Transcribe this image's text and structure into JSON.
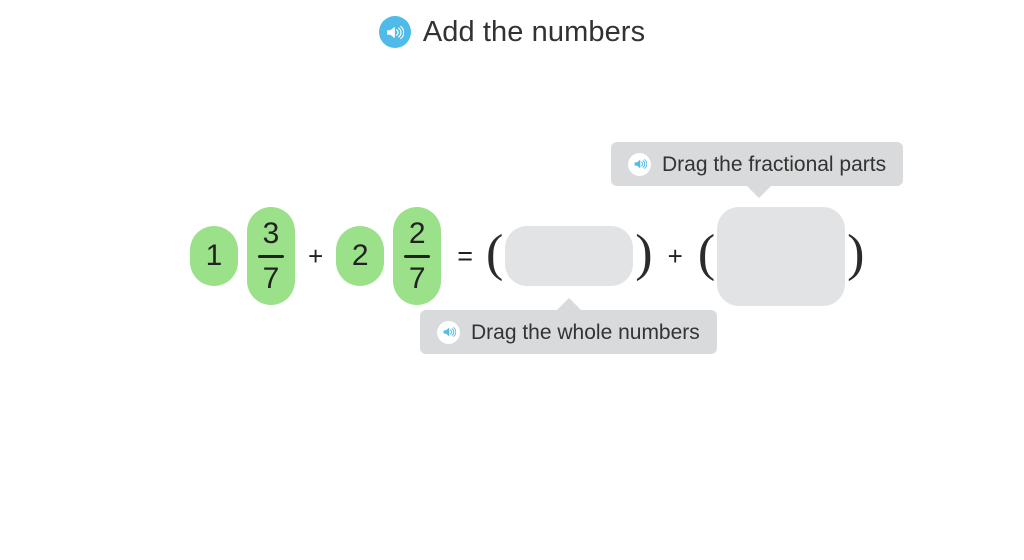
{
  "header": {
    "title": "Add the numbers",
    "speaker_icon": "speaker-icon",
    "accent_color": "#4fbbe8",
    "title_color": "#323232"
  },
  "colors": {
    "tile_green": "#9ae189",
    "dropzone_grey": "#e2e3e4",
    "tooltip_grey": "#d9dadb",
    "text_dark": "#222222",
    "page_background": "#ffffff"
  },
  "equation": {
    "operand_a": {
      "whole": "1",
      "numerator": "3",
      "denominator": "7"
    },
    "operator_add_1": "+",
    "operand_b": {
      "whole": "2",
      "numerator": "2",
      "denominator": "7"
    },
    "operator_equals": "=",
    "paren_open_1": "(",
    "dropzone_whole": {
      "value": "",
      "placeholder": ""
    },
    "paren_close_1": ")",
    "operator_add_2": "+",
    "paren_open_2": "(",
    "dropzone_fraction": {
      "value": "",
      "placeholder": ""
    },
    "paren_close_2": ")"
  },
  "tooltips": {
    "fractional": {
      "label": "Drag the fractional parts",
      "speaker_icon": "speaker-icon",
      "arrow": "down"
    },
    "whole": {
      "label": "Drag the whole numbers",
      "speaker_icon": "speaker-icon",
      "arrow": "up"
    }
  }
}
